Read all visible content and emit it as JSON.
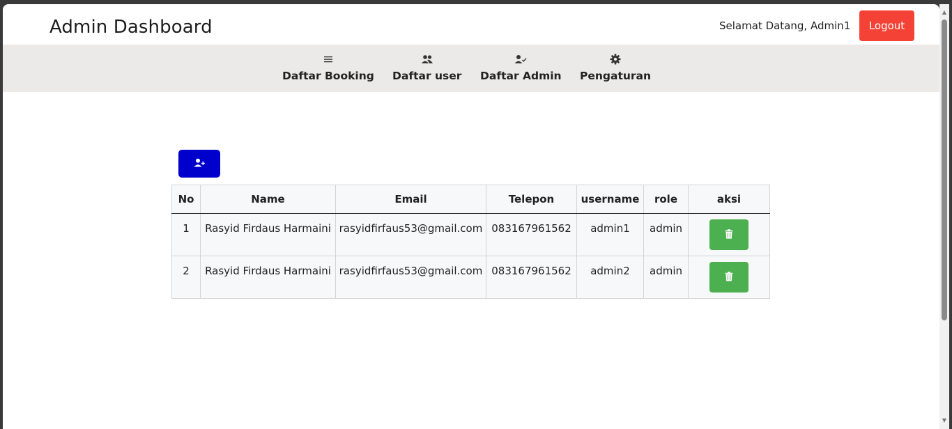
{
  "header": {
    "title": "Admin Dashboard",
    "welcome": "Selamat Datang, Admin1",
    "logout_label": "Logout"
  },
  "nav": {
    "items": [
      {
        "label": "Daftar Booking",
        "icon": "menu-icon"
      },
      {
        "label": "Daftar user",
        "icon": "users-icon"
      },
      {
        "label": "Daftar Admin",
        "icon": "user-check-icon"
      },
      {
        "label": "Pengaturan",
        "icon": "gear-icon"
      }
    ]
  },
  "toolbar": {
    "add_icon": "user-plus-icon"
  },
  "table": {
    "columns": [
      "No",
      "Name",
      "Email",
      "Telepon",
      "username",
      "role",
      "aksi"
    ],
    "rows": [
      {
        "no": "1",
        "name": "Rasyid Firdaus Harmaini",
        "email": "rasyidfirfaus53@gmail.com",
        "telepon": "083167961562",
        "username": "admin1",
        "role": "admin",
        "action_icon": "trash-icon"
      },
      {
        "no": "2",
        "name": "Rasyid Firdaus Harmaini",
        "email": "rasyidfirfaus53@gmail.com",
        "telepon": "083167961562",
        "username": "admin2",
        "role": "admin",
        "action_icon": "trash-icon"
      }
    ]
  },
  "colors": {
    "logout": "#f44336",
    "add_button": "#0000cd",
    "delete_button": "#4caf50",
    "nav_background": "#ebeae8"
  }
}
